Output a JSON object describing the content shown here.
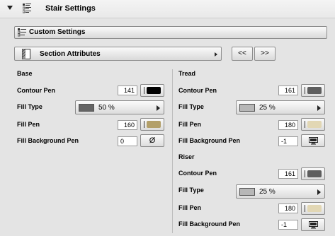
{
  "header": {
    "title": "Stair Settings"
  },
  "custom_settings": {
    "label": "Custom Settings"
  },
  "section_attributes": {
    "label": "Section Attributes",
    "prev_label": "<<",
    "next_label": ">>"
  },
  "base": {
    "heading": "Base",
    "contour_pen": {
      "label": "Contour Pen",
      "value": "141",
      "color": "#000000"
    },
    "fill_type": {
      "label": "Fill Type",
      "value": "50 %"
    },
    "fill_pen": {
      "label": "Fill Pen",
      "value": "160",
      "color": "#b3a06a"
    },
    "fill_background_pen": {
      "label": "Fill Background Pen",
      "value": "0",
      "symbol": "Ø"
    }
  },
  "tread": {
    "heading": "Tread",
    "contour_pen": {
      "label": "Contour Pen",
      "value": "161",
      "color": "#5e5e5e"
    },
    "fill_type": {
      "label": "Fill Type",
      "value": "25 %"
    },
    "fill_pen": {
      "label": "Fill Pen",
      "value": "180",
      "color": "#e2d7b4"
    },
    "fill_background_pen": {
      "label": "Fill Background Pen",
      "value": "-1"
    }
  },
  "riser": {
    "heading": "Riser",
    "contour_pen": {
      "label": "Contour Pen",
      "value": "161",
      "color": "#5e5e5e"
    },
    "fill_type": {
      "label": "Fill Type",
      "value": "25 %"
    },
    "fill_pen": {
      "label": "Fill Pen",
      "value": "180",
      "color": "#e2d7b4"
    },
    "fill_background_pen": {
      "label": "Fill Background Pen",
      "value": "-1"
    }
  }
}
